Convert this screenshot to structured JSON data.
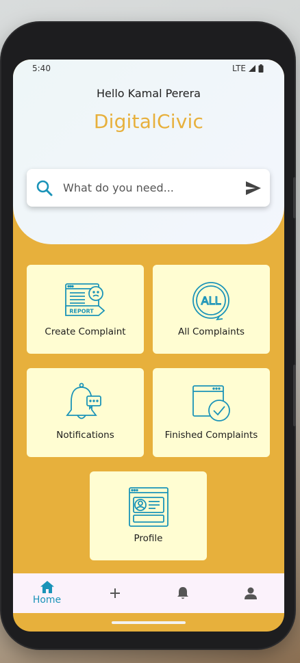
{
  "status": {
    "time": "5:40",
    "network": "LTE"
  },
  "header": {
    "greeting": "Hello Kamal Perera",
    "brand": "DigitalCivic"
  },
  "search": {
    "placeholder": "What do you need...",
    "icon": "search-icon",
    "send_icon": "send-icon"
  },
  "tiles": [
    {
      "label": "Create Complaint",
      "icon": "report-icon"
    },
    {
      "label": "All Complaints",
      "icon": "all-icon"
    },
    {
      "label": "Notifications",
      "icon": "bell-icon"
    },
    {
      "label": "Finished Complaints",
      "icon": "window-check-icon"
    },
    {
      "label": "Profile",
      "icon": "profile-card-icon"
    }
  ],
  "nav": [
    {
      "label": "Home",
      "icon": "home-icon",
      "active": true
    },
    {
      "label": "",
      "icon": "plus-icon",
      "active": false
    },
    {
      "label": "",
      "icon": "bell-icon",
      "active": false
    },
    {
      "label": "",
      "icon": "person-icon",
      "active": false
    }
  ],
  "colors": {
    "accent": "#e7b03c",
    "tile": "#fffdd2",
    "icon": "#1a93b8",
    "nav_bg": "#fbf2fb"
  },
  "report_badge_text": "REPORT",
  "all_badge_text": "ALL"
}
